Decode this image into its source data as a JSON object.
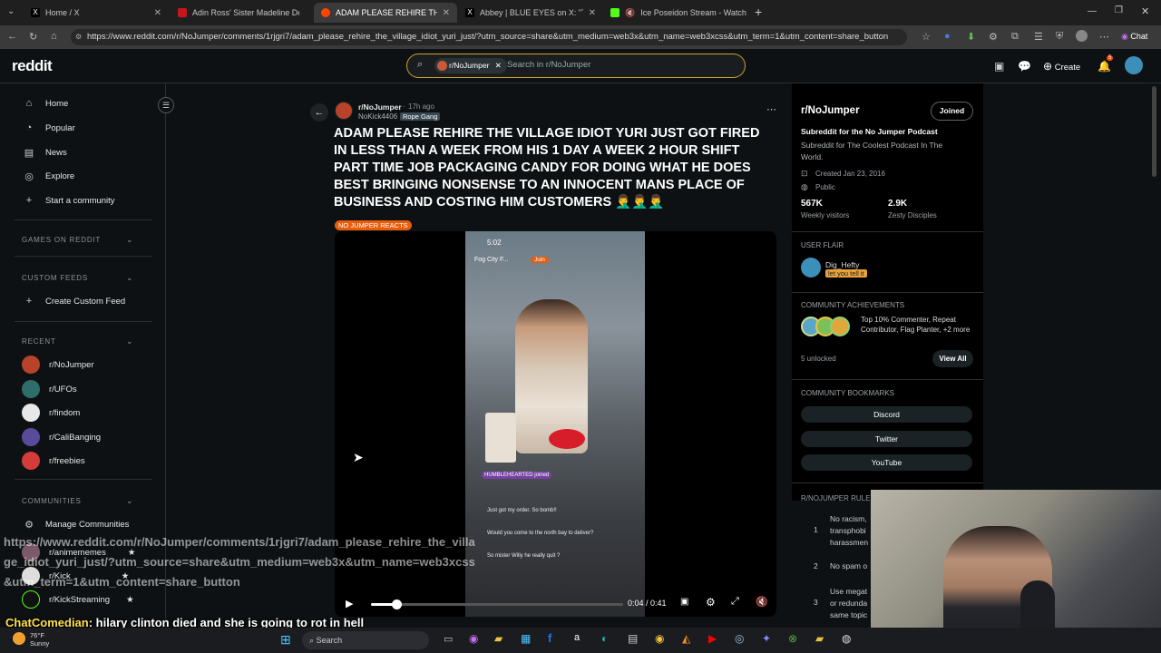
{
  "tabs": [
    {
      "title": "Home / X"
    },
    {
      "title": "Adin Ross' Sister Madeline Dead a"
    },
    {
      "title": "ADAM PLEASE REHIRE THE VILLAG"
    },
    {
      "title": "Abbey | BLUE EYES on X: \"The Pizz"
    },
    {
      "title": "Ice Poseidon Stream - Watch"
    }
  ],
  "browser": {
    "url": "https://www.reddit.com/r/NoJumper/comments/1rjgri7/adam_please_rehire_the_village_idiot_yuri_just/?utm_source=share&utm_medium=web3x&utm_name=web3xcss&utm_term=1&utm_content=share_button",
    "chat_label": "Chat"
  },
  "header": {
    "logo": "reddit",
    "search_chip": "r/NoJumper",
    "search_placeholder": "Search in r/NoJumper",
    "create_label": "Create",
    "notif_count": "5"
  },
  "sidebar": {
    "nav": [
      {
        "label": "Home"
      },
      {
        "label": "Popular"
      },
      {
        "label": "News"
      },
      {
        "label": "Explore"
      },
      {
        "label": "Start a community"
      }
    ],
    "games_heading": "GAMES ON REDDIT",
    "custom_heading": "CUSTOM FEEDS",
    "create_feed": "Create Custom Feed",
    "recent_heading": "RECENT",
    "recent": [
      {
        "label": "r/NoJumper"
      },
      {
        "label": "r/UFOs"
      },
      {
        "label": "r/findom"
      },
      {
        "label": "r/CaliBanging"
      },
      {
        "label": "r/freebies"
      }
    ],
    "communities_heading": "COMMUNITIES",
    "manage": "Manage Communities",
    "communities": [
      {
        "label": "r/animememes"
      },
      {
        "label": "r/Kick"
      },
      {
        "label": "r/KickStreaming"
      }
    ]
  },
  "post": {
    "subreddit": "r/NoJumper",
    "time": "17h ago",
    "author": "NoKick4406",
    "author_flair": "Rope Gang",
    "title": "ADAM PLEASE REHIRE THE VILLAGE IDIOT YURI JUST GOT FIRED IN LESS THAN A WEEK FROM HIS 1 DAY A WEEK 2 HOUR SHIFT PART TIME JOB PACKAGING CANDY FOR DOING WHAT HE DOES BEST BRINGING NONSENSE TO AN INNOCENT MANS PLACE OF BUSINESS AND COSTING HIM CUSTOMERS 🤦‍♂️🤦‍♂️🤦‍♂️",
    "post_flair": "NO JUMPER REACTS",
    "video_time": "0:04 / 0:41",
    "video_progress": 0.1,
    "video_overlay": {
      "clock": "5:02",
      "channel": "Fog City F...",
      "join": "Join",
      "badge_name": "HUMBLEHEARTED",
      "badge_action": "joined",
      "chat1": "Just got my order. So bomb!!",
      "chat2": "Would you come to the north bay to deliver?",
      "chat3": "So mister Willy he really quit ?"
    }
  },
  "right_sidebar": {
    "name": "r/NoJumper",
    "joined": "Joined",
    "tagline": "Subreddit for the No Jumper Podcast",
    "description": "Subreddit for The Coolest Podcast In The World.",
    "created": "Created Jan 23, 2016",
    "visibility": "Public",
    "visitors_value": "567K",
    "visitors_label": "Weekly visitors",
    "members_value": "2.9K",
    "members_label": "Zesty Disciples",
    "user_flair_heading": "USER FLAIR",
    "user_name": "Dig_Hefty",
    "user_flair": "let you tell it",
    "achievements_heading": "COMMUNITY ACHIEVEMENTS",
    "achievements_text": "Top 10% Commenter, Repeat Contributor, Flag Planter, +2 more",
    "unlocked": "5 unlocked",
    "view_all": "View All",
    "bookmarks_heading": "COMMUNITY BOOKMARKS",
    "bookmarks": [
      {
        "label": "Discord"
      },
      {
        "label": "Twitter"
      },
      {
        "label": "YouTube"
      }
    ],
    "rules_heading": "R/NOJUMPER RULES",
    "rules": [
      {
        "n": "1",
        "text": "No racism, transphobi harassmen"
      },
      {
        "n": "2",
        "text": "No spam o"
      },
      {
        "n": "3",
        "text": "Use megat or redunda same topic"
      }
    ]
  },
  "overlays": {
    "url_text": "https://www.reddit.com/r/NoJumper/comments/1rjgri7/adam_please_rehire_the_village_idiot_yuri_just/?utm_source=share&utm_medium=web3x&utm_name=web3xcss&utm_term=1&utm_content=share_button",
    "chat_user": "ChatComedian",
    "chat_message": ": hilary clinton died and she is going to rot in hell"
  },
  "taskbar": {
    "temp": "76°F",
    "weather": "Sunny",
    "search": "Search"
  },
  "colors": {
    "accent_orange": "#ff4500",
    "search_border": "#d0a02a",
    "flair_orange": "#e85d0c",
    "rope_flair": "#3a4a55"
  }
}
